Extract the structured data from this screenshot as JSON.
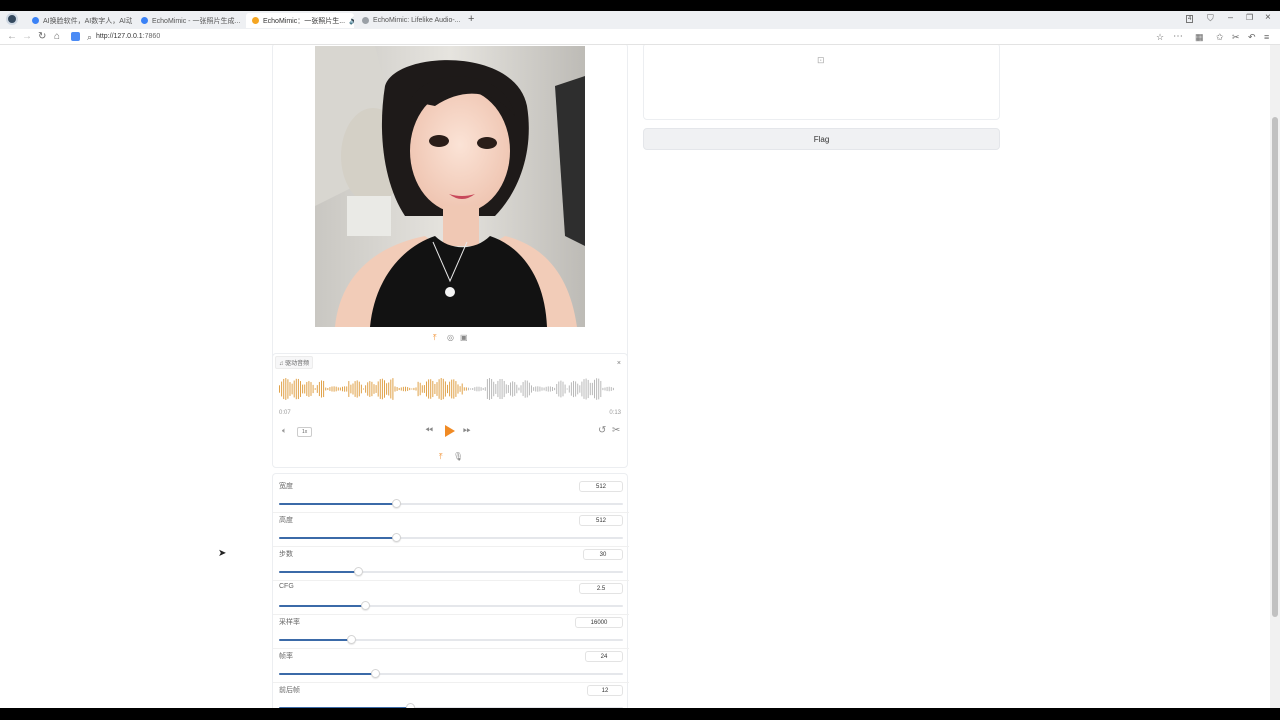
{
  "browser": {
    "tabs": [
      {
        "title": "AI换脸软件，AI数字人，AI动",
        "active": false,
        "fav_color": "#3b82f6"
      },
      {
        "title": "EchoMimic - 一张照片生成...",
        "active": false,
        "fav_color": "#3b82f6"
      },
      {
        "title": "EchoMimic：一张照片生...",
        "active": true,
        "fav_color": "#f5a623"
      },
      {
        "title": "EchoMimic: Lifelike Audio-...",
        "active": false,
        "fav_color": "#9aa0a6"
      }
    ],
    "new_tab": "+",
    "window_badge": "4",
    "url_host": "http://127.0.0.1",
    "url_port": ":7860"
  },
  "icons": {
    "back": "arrow-left-icon",
    "forward": "arrow-right-icon",
    "reload": "reload-icon",
    "home": "home-icon",
    "search": "search-icon",
    "star": "star-icon",
    "menu": "menu-icon"
  },
  "image_panel": {
    "upload_icon": "upload-icon",
    "webcam_icon": "webcam-icon",
    "clipboard_icon": "clipboard-icon"
  },
  "audio_panel": {
    "label": "驱动音频",
    "time_start": "0:07",
    "time_end": "0:13",
    "speed": "1x",
    "played_fraction": 0.56,
    "played_color": "#e0a24a",
    "unplayed_color": "#b9b9b9"
  },
  "sliders": [
    {
      "label": "宽度",
      "value": "512",
      "fill": 0.34
    },
    {
      "label": "高度",
      "value": "512",
      "fill": 0.34
    },
    {
      "label": "步数",
      "value": "30",
      "fill": 0.23
    },
    {
      "label": "CFG",
      "value": "2.5",
      "fill": 0.25
    },
    {
      "label": "采样率",
      "value": "16000",
      "fill": 0.21
    },
    {
      "label": "帧率",
      "value": "24",
      "fill": 0.28
    },
    {
      "label": "前后帧",
      "value": "12",
      "fill": 0.38
    }
  ],
  "video_panel": {
    "icon": "video-camera-icon"
  },
  "flag_button": "Flag",
  "colors": {
    "accent": "#f08a24",
    "slider": "#3b6aa8"
  }
}
